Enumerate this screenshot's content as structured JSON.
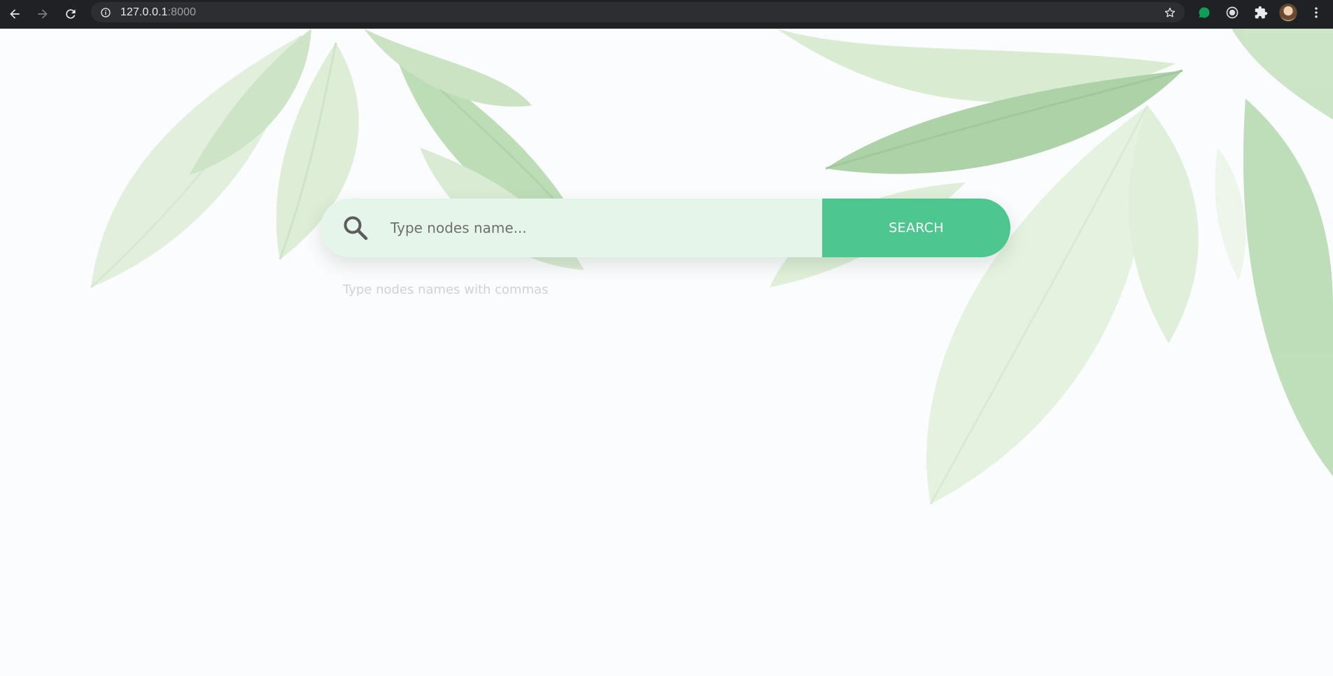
{
  "browser": {
    "url_host": "127.0.0.1",
    "url_port": ":8000",
    "icons": {
      "back": "arrow-left-icon",
      "forward": "arrow-right-icon",
      "reload": "reload-icon",
      "site_info": "info-icon",
      "bookmark": "star-icon",
      "extensions": [
        "green-chat-extension-icon",
        "record-extension-icon",
        "puzzle-extensions-icon"
      ],
      "menu": "kebab-menu-icon"
    }
  },
  "search": {
    "placeholder": "Type nodes name...",
    "value": "",
    "button_label": "SEARCH",
    "hint": "Type nodes names with commas"
  },
  "colors": {
    "accent_green": "#4dc68f",
    "input_background": "#e5f5ea",
    "page_background": "#fbfcfd",
    "chrome_dark": "#202124"
  }
}
